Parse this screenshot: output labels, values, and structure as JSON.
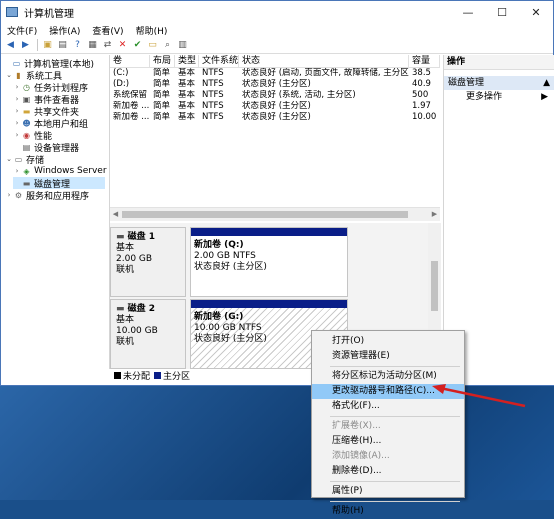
{
  "window": {
    "title": "计算机管理",
    "controls": {
      "minimize": "—",
      "maximize": "☐",
      "close": "✕"
    }
  },
  "menubar": [
    "文件(F)",
    "操作(A)",
    "查看(V)",
    "帮助(H)"
  ],
  "tree": {
    "items": [
      {
        "label": "计算机管理(本地)",
        "icon": "computer-icon"
      },
      {
        "label": "系统工具",
        "icon": "tools-icon"
      },
      {
        "label": "任务计划程序",
        "icon": "clock-icon"
      },
      {
        "label": "事件查看器",
        "icon": "event-viewer-icon"
      },
      {
        "label": "共享文件夹",
        "icon": "folder-icon"
      },
      {
        "label": "本地用户和组",
        "icon": "users-icon"
      },
      {
        "label": "性能",
        "icon": "performance-icon"
      },
      {
        "label": "设备管理器",
        "icon": "device-manager-icon"
      },
      {
        "label": "存储",
        "icon": "storage-icon"
      },
      {
        "label": "Windows Server I",
        "icon": "backup-icon"
      },
      {
        "label": "磁盘管理",
        "icon": "disk-icon"
      },
      {
        "label": "服务和应用程序",
        "icon": "services-icon"
      }
    ]
  },
  "volumes": {
    "columns": [
      "卷",
      "布局",
      "类型",
      "文件系统",
      "状态",
      "容量"
    ],
    "rows": [
      [
        "(C:)",
        "简单",
        "基本",
        "NTFS",
        "状态良好 (启动, 页面文件, 故障转储, 主分区)",
        "38.5"
      ],
      [
        "(D:)",
        "简单",
        "基本",
        "NTFS",
        "状态良好 (主分区)",
        "40.9"
      ],
      [
        "系统保留",
        "简单",
        "基本",
        "NTFS",
        "状态良好 (系统, 活动, 主分区)",
        "500"
      ],
      [
        "新加卷 ...",
        "简单",
        "基本",
        "NTFS",
        "状态良好 (主分区)",
        "1.97"
      ],
      [
        "新加卷 ...",
        "简单",
        "基本",
        "NTFS",
        "状态良好 (主分区)",
        "10.00"
      ]
    ]
  },
  "disks": [
    {
      "name": "磁盘 1",
      "type": "基本",
      "size": "2.00 GB",
      "status": "联机",
      "partition": {
        "name": "新加卷 (Q:)",
        "size": "2.00 GB NTFS",
        "status": "状态良好 (主分区)"
      }
    },
    {
      "name": "磁盘 2",
      "type": "基本",
      "size": "10.00 GB",
      "status": "联机",
      "partition": {
        "name": "新加卷 (G:)",
        "size": "10.00 GB NTFS",
        "status": "状态良好 (主分区)"
      }
    }
  ],
  "legend": {
    "unallocated": "未分配",
    "primary": "主分区"
  },
  "actions": {
    "header": "操作",
    "section": "磁盘管理",
    "more": "更多操作"
  },
  "context_menu": {
    "items": [
      {
        "label": "打开(O)",
        "enabled": true
      },
      {
        "label": "资源管理器(E)",
        "enabled": true
      },
      {
        "label": "将分区标记为活动分区(M)",
        "enabled": true
      },
      {
        "label": "更改驱动器号和路径(C)...",
        "enabled": true,
        "highlighted": true
      },
      {
        "label": "格式化(F)...",
        "enabled": true
      },
      {
        "label": "扩展卷(X)...",
        "enabled": false
      },
      {
        "label": "压缩卷(H)...",
        "enabled": true
      },
      {
        "label": "添加镜像(A)...",
        "enabled": false
      },
      {
        "label": "删除卷(D)...",
        "enabled": true
      },
      {
        "label": "属性(P)",
        "enabled": true
      },
      {
        "label": "帮助(H)",
        "enabled": true
      }
    ]
  },
  "colors": {
    "primary_partition": "#0a1e88",
    "highlight": "#91c9f7",
    "annotation_arrow": "#d42020"
  }
}
